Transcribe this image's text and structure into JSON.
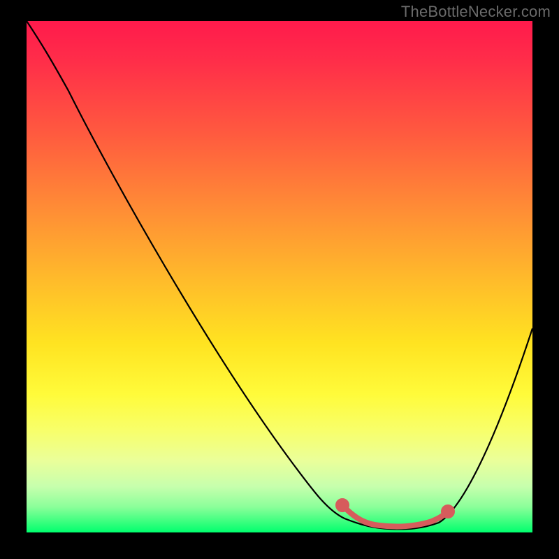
{
  "attribution": "TheBottleNecker.com",
  "colors": {
    "frame": "#000000",
    "curve_stroke": "#000000",
    "highlight_stroke": "#d65c5c",
    "attribution_text": "#6b6b6b"
  },
  "chart_data": {
    "type": "line",
    "title": "",
    "xlabel": "",
    "ylabel": "",
    "xlim": [
      0,
      100
    ],
    "ylim": [
      0,
      100
    ],
    "series": [
      {
        "name": "bottleneck-curve",
        "x": [
          0,
          5,
          12,
          20,
          28,
          36,
          44,
          52,
          58,
          62,
          66,
          70,
          74,
          78,
          82,
          88,
          94,
          100
        ],
        "y": [
          100,
          94,
          85,
          74,
          63,
          52,
          41,
          30,
          21,
          14,
          8,
          3,
          1,
          0.5,
          1,
          10,
          24,
          40
        ]
      },
      {
        "name": "optimal-range",
        "x": [
          62,
          66,
          70,
          74,
          78,
          82
        ],
        "y": [
          6,
          1.8,
          0.8,
          0.6,
          0.8,
          2.4
        ]
      }
    ],
    "annotations": []
  }
}
